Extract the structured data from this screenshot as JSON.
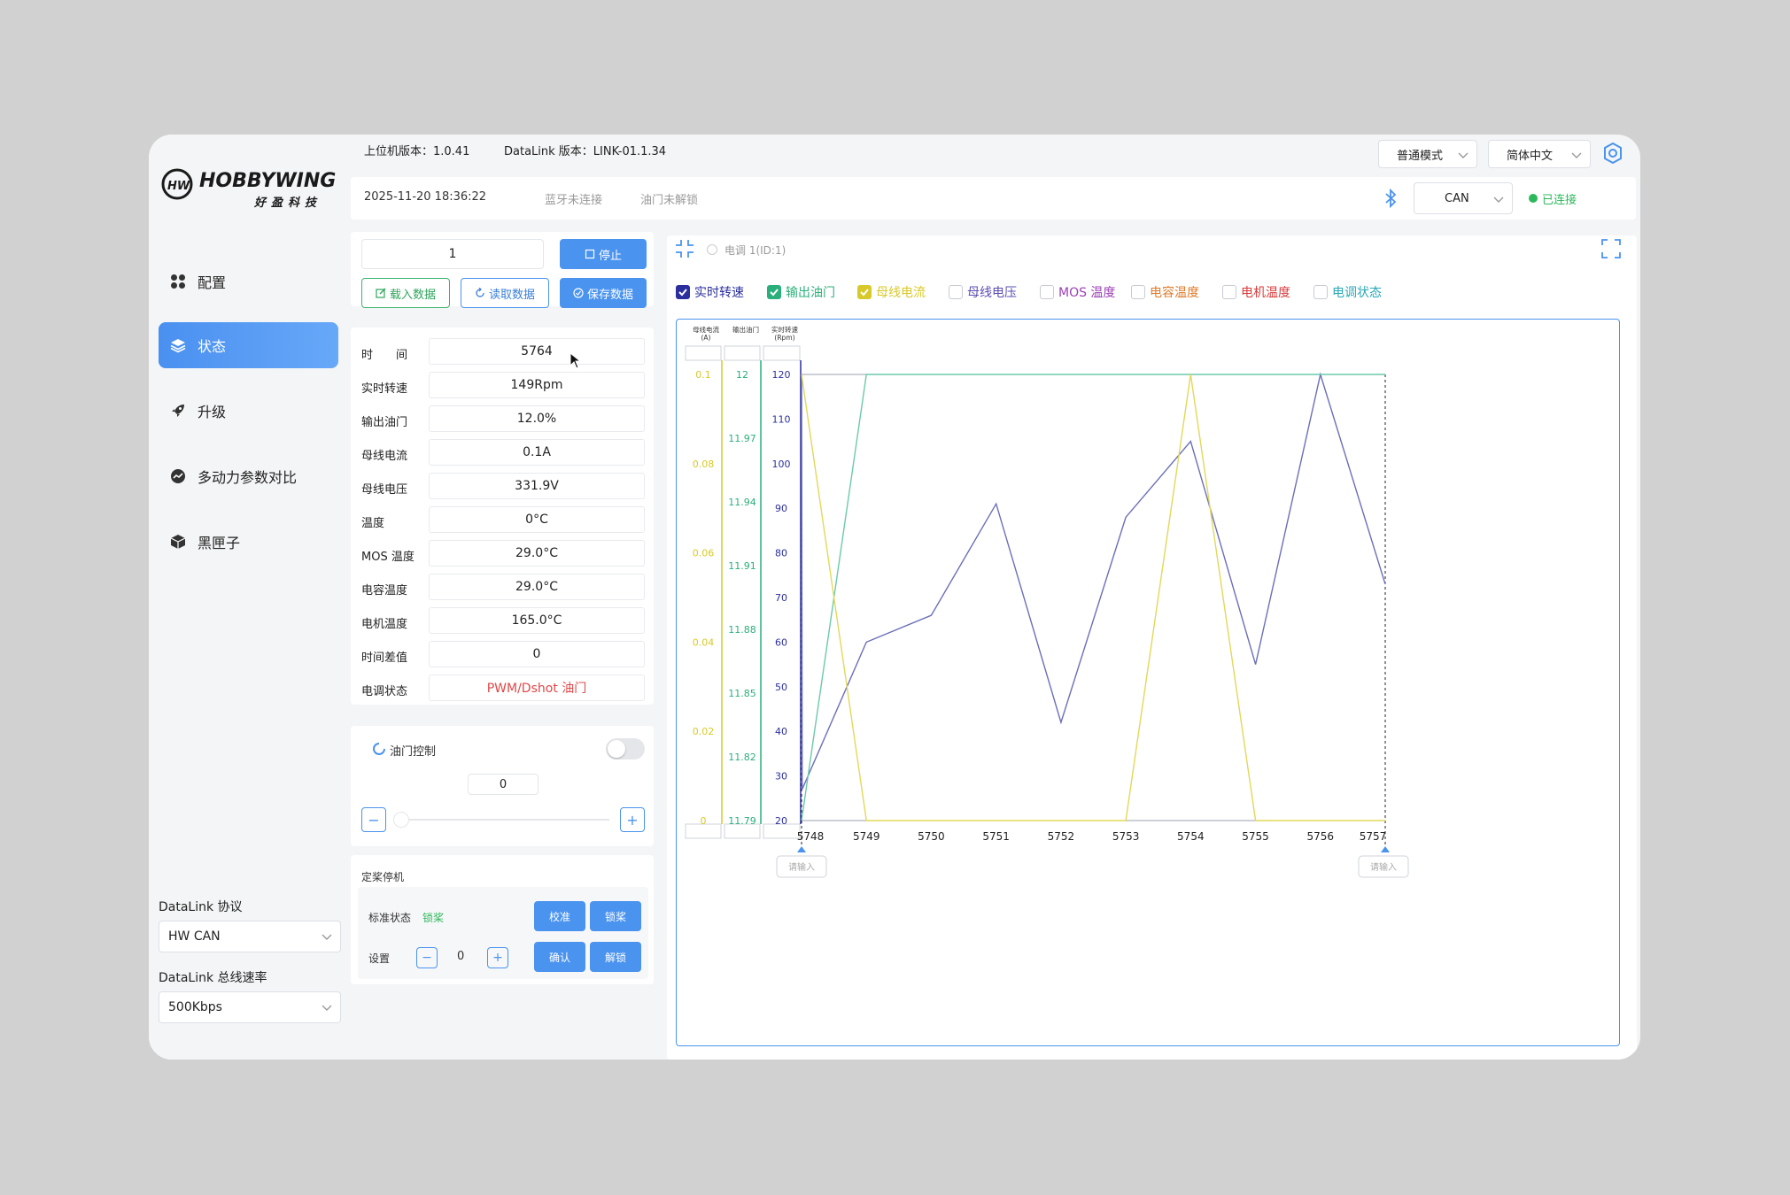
{
  "logo": {
    "brand": "HOBBYWING",
    "brand_cn": "好盈科技",
    "mark": "HW"
  },
  "header": {
    "host_version": "上位机版本：1.0.41",
    "datalink_version": "DataLink 版本：LINK-01.1.34",
    "mode_select": "普通模式",
    "language_select": "简体中文"
  },
  "statusbar": {
    "datetime": "2025-11-20 18:36:22",
    "bluetooth": "蓝牙未连接",
    "throttle_lock": "油门未解锁",
    "bus_select": "CAN",
    "connection": "已连接"
  },
  "sidebar": {
    "items": [
      {
        "label": "配置",
        "icon": "grid-icon"
      },
      {
        "label": "状态",
        "icon": "layers-icon"
      },
      {
        "label": "升级",
        "icon": "rocket-icon"
      },
      {
        "label": "多动力参数对比",
        "icon": "compare-icon"
      },
      {
        "label": "黑匣子",
        "icon": "box-icon"
      }
    ],
    "protocol_label": "DataLink 协议",
    "protocol_value": "HW CAN",
    "baud_label": "DataLink 总线速率",
    "baud_value": "500Kbps"
  },
  "data_panel": {
    "id_input": "1",
    "stop_label": "停止",
    "load_label": "载入数据",
    "read_label": "读取数据",
    "save_label": "保存数据",
    "rows": [
      {
        "label": "时　　间",
        "value": "5764"
      },
      {
        "label": "实时转速",
        "value": "149Rpm"
      },
      {
        "label": "输出油门",
        "value": "12.0%"
      },
      {
        "label": "母线电流",
        "value": "0.1A"
      },
      {
        "label": "母线电压",
        "value": "331.9V"
      },
      {
        "label": "温度",
        "value": "0°C"
      },
      {
        "label": "MOS 温度",
        "value": "29.0°C"
      },
      {
        "label": "电容温度",
        "value": "29.0°C"
      },
      {
        "label": "电机温度",
        "value": "165.0°C"
      },
      {
        "label": "时间差值",
        "value": "0"
      },
      {
        "label": "电调状态",
        "value": "PWM/Dshot 油门"
      }
    ]
  },
  "throttle_panel": {
    "title": "油门控制",
    "value": "0",
    "minus": "−",
    "plus": "+",
    "slider_level": 0
  },
  "prop_panel": {
    "title": "定桨停机",
    "status_label": "标准状态",
    "status_value": "锁桨",
    "calibrate": "校准",
    "lock": "锁桨",
    "set_label": "设置",
    "set_value": "0",
    "confirm": "确认",
    "unlock": "解锁"
  },
  "chart_header": {
    "device": "电调 1(ID:1)"
  },
  "checkboxes": [
    {
      "label": "实时转速",
      "checked": true,
      "color": "#2b2f9e"
    },
    {
      "label": "输出油门",
      "checked": true,
      "color": "#2aaf7a"
    },
    {
      "label": "母线电流",
      "checked": true,
      "color": "#d8c92a"
    },
    {
      "label": "母线电压",
      "checked": false,
      "color": "#5a4fb5"
    },
    {
      "label": "MOS 温度",
      "checked": false,
      "color": "#9b3fb5"
    },
    {
      "label": "电容温度",
      "checked": false,
      "color": "#e07a2a"
    },
    {
      "label": "电机温度",
      "checked": false,
      "color": "#d83a3a"
    },
    {
      "label": "电调状态",
      "checked": false,
      "color": "#2aa8b8"
    }
  ],
  "axis_headers": {
    "current": [
      "母线电流",
      "(A)"
    ],
    "throttle": [
      "输出油门"
    ],
    "rpm": [
      "实时转速",
      "(Rpm)"
    ]
  },
  "range_inputs": {
    "left": "请输入",
    "right": "请输入"
  },
  "chart_data": {
    "type": "line",
    "x": [
      5748,
      5749,
      5750,
      5751,
      5752,
      5753,
      5754,
      5755,
      5756,
      5757
    ],
    "x_ticks": [
      "5748",
      "5749",
      "5750",
      "5751",
      "5752",
      "5753",
      "5754",
      "5755",
      "5756",
      "5757"
    ],
    "axes": [
      {
        "name": "母线电流",
        "unit": "A",
        "ticks": [
          "0.1",
          "0.08",
          "0.06",
          "0.04",
          "0.02",
          "0"
        ],
        "range": [
          0,
          0.1
        ],
        "color": "#d8c92a"
      },
      {
        "name": "输出油门",
        "ticks": [
          "12",
          "11.97",
          "11.94",
          "11.91",
          "11.88",
          "11.85",
          "11.82",
          "11.79"
        ],
        "range": [
          11.79,
          12
        ],
        "color": "#2aaf7a"
      },
      {
        "name": "实时转速",
        "unit": "Rpm",
        "ticks": [
          "120",
          "110",
          "100",
          "90",
          "80",
          "70",
          "60",
          "50",
          "40",
          "30",
          "20"
        ],
        "range": [
          20,
          120
        ],
        "color": "#2b2f9e"
      }
    ],
    "series": [
      {
        "name": "实时转速",
        "color": "#6a6fb8",
        "points": [
          [
            5748,
            120
          ],
          [
            5748.01,
            27
          ],
          [
            5749,
            60
          ],
          [
            5750,
            66
          ],
          [
            5751,
            91
          ],
          [
            5752,
            42
          ],
          [
            5753,
            88
          ],
          [
            5754,
            105
          ],
          [
            5755,
            55
          ],
          [
            5756,
            120
          ],
          [
            5757,
            73
          ]
        ]
      },
      {
        "name": "输出油门",
        "color": "#6cc9ab",
        "points": [
          [
            5748,
            11.79
          ],
          [
            5749,
            12
          ],
          [
            5757,
            12
          ]
        ]
      },
      {
        "name": "母线电流",
        "color": "#e2d85a",
        "points": [
          [
            5748,
            0.1
          ],
          [
            5749,
            0
          ],
          [
            5753,
            0
          ],
          [
            5754,
            0.1
          ],
          [
            5755,
            0
          ],
          [
            5757,
            0
          ]
        ]
      }
    ]
  }
}
